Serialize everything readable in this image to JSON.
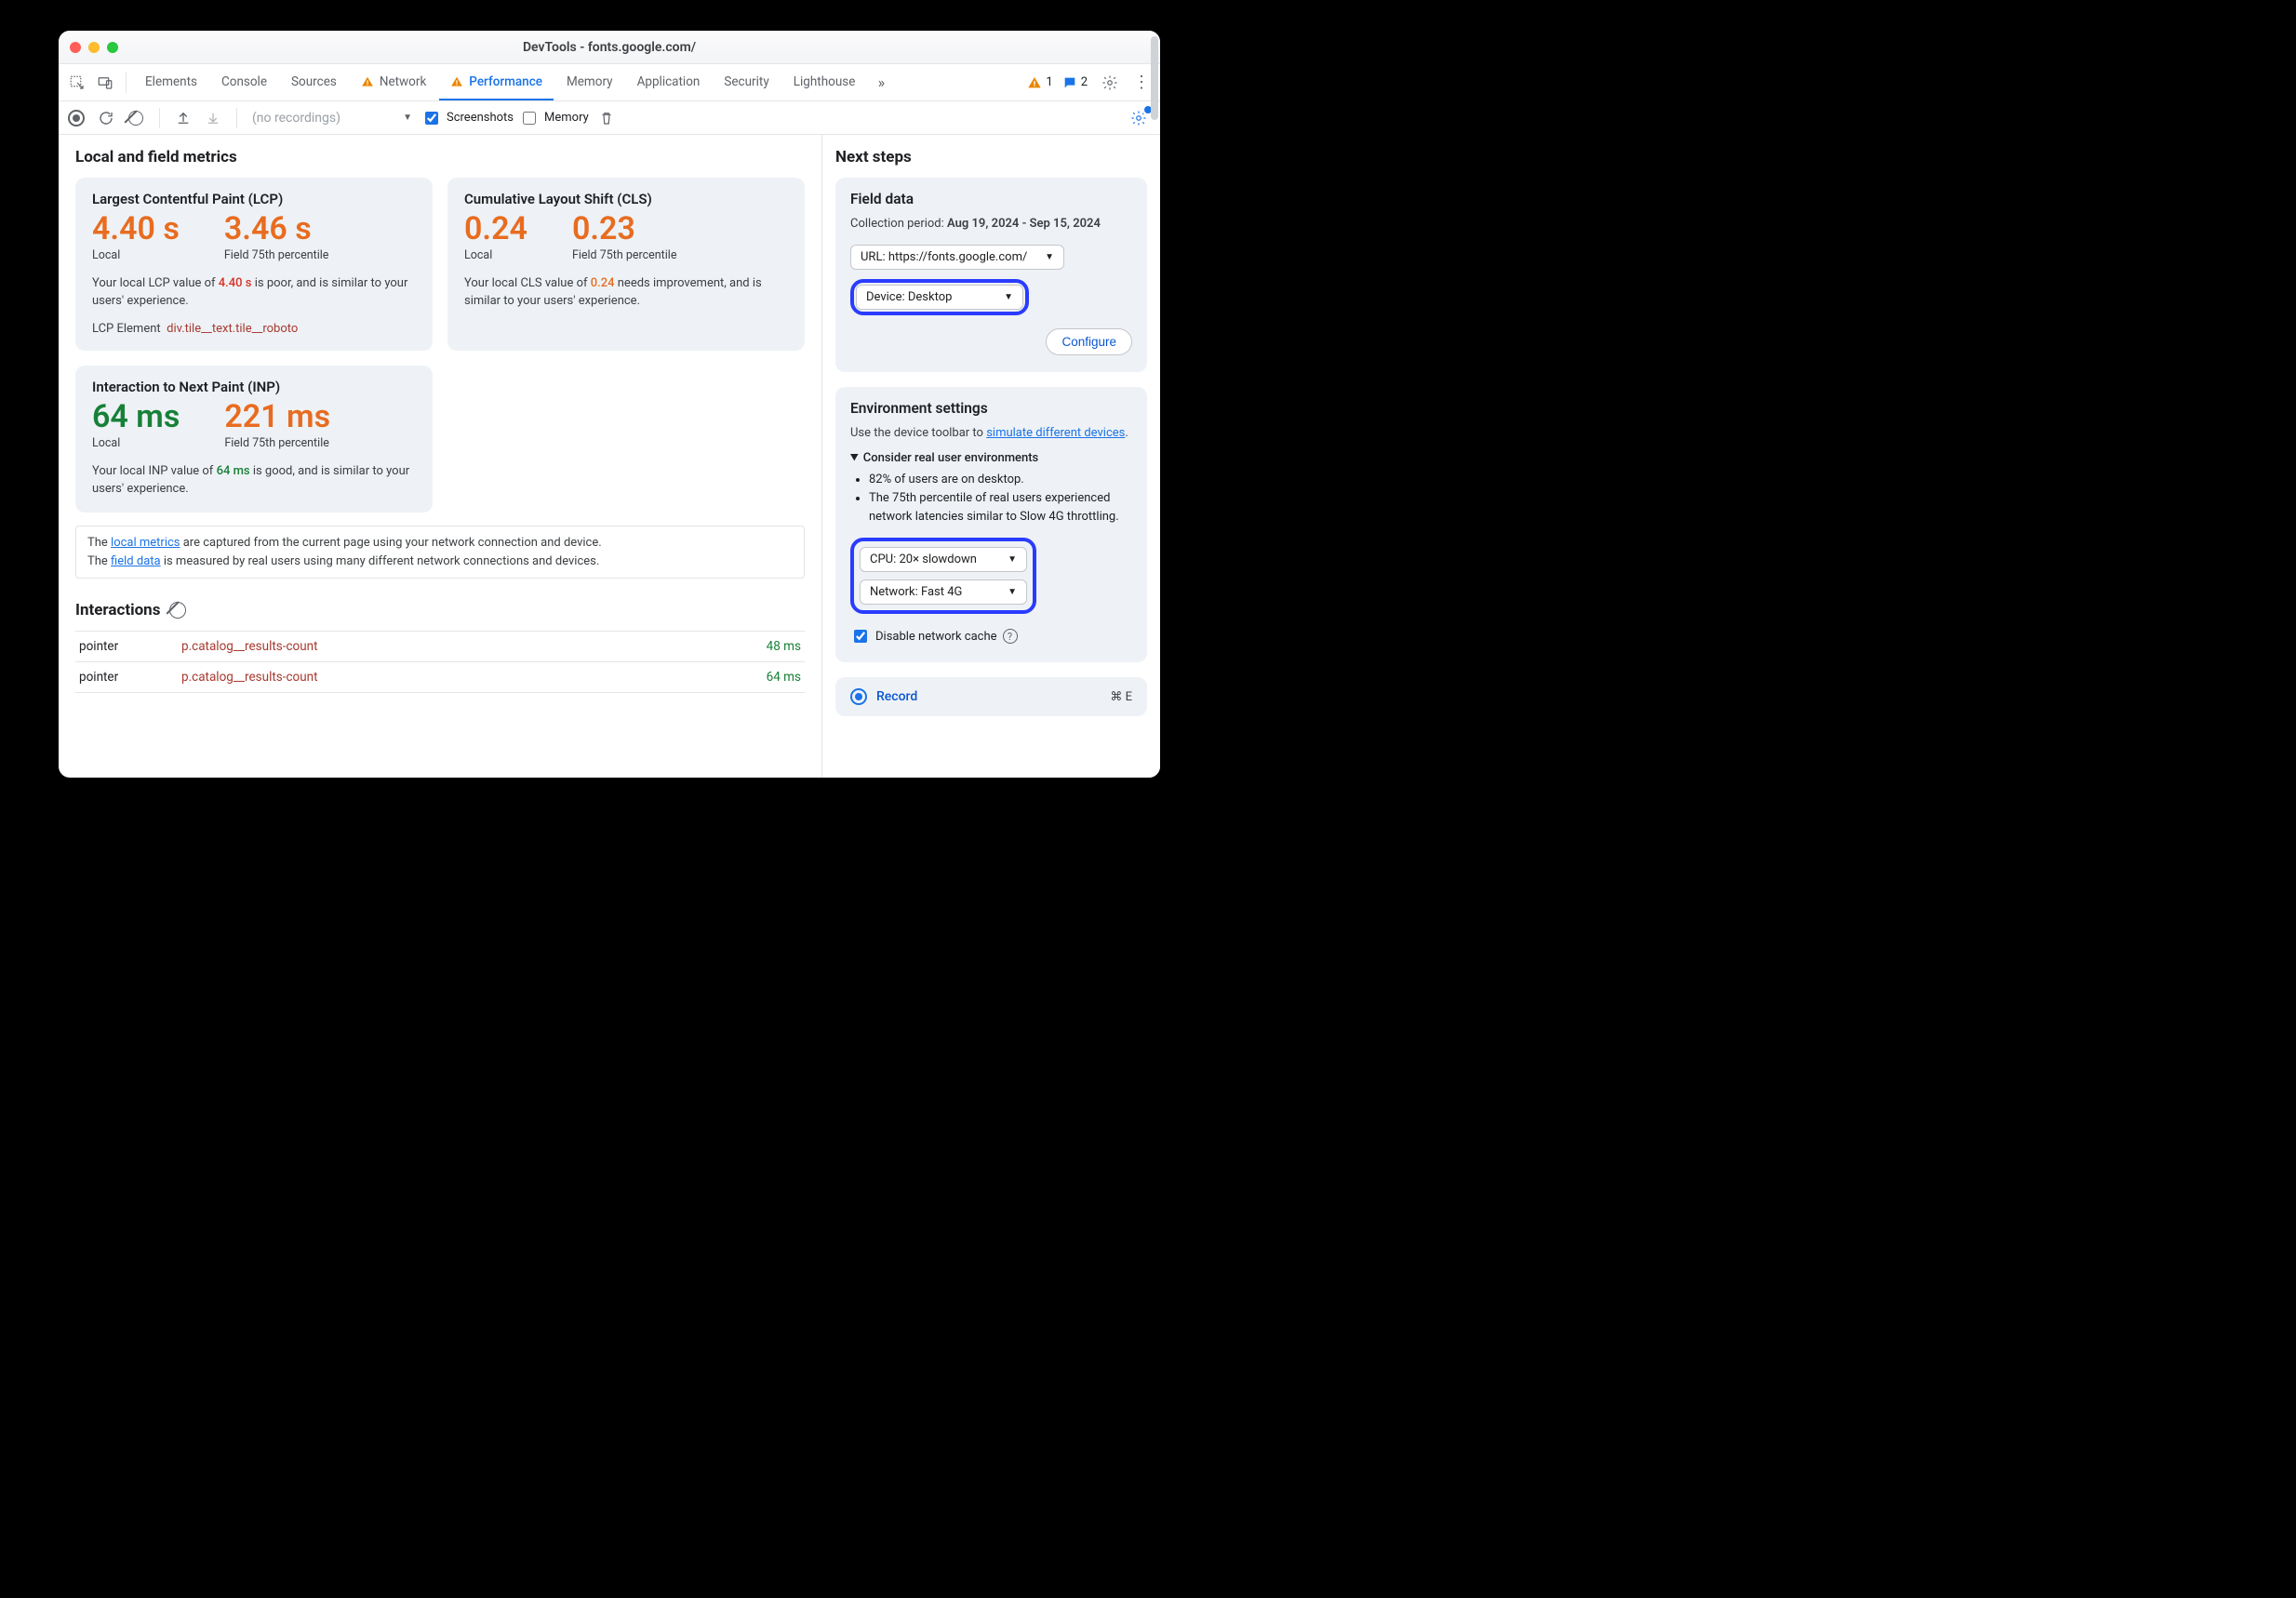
{
  "window": {
    "title": "DevTools - fonts.google.com/"
  },
  "tabs": {
    "items": [
      "Elements",
      "Console",
      "Sources",
      "Network",
      "Performance",
      "Memory",
      "Application",
      "Security",
      "Lighthouse"
    ],
    "warn_tabs": [
      "Network",
      "Performance"
    ],
    "active": "Performance"
  },
  "status": {
    "warnings": "1",
    "messages": "2"
  },
  "toolbar2": {
    "recordings_placeholder": "(no recordings)",
    "cb_screenshots": "Screenshots",
    "cb_memory": "Memory"
  },
  "main": {
    "heading": "Local and field metrics",
    "lcp": {
      "title": "Largest Contentful Paint (LCP)",
      "local_value": "4.40 s",
      "local_label": "Local",
      "field_value": "3.46 s",
      "field_label": "Field 75th percentile",
      "desc_pre": "Your local LCP value of ",
      "desc_val": "4.40 s",
      "desc_post": " is poor, and is similar to your users' experience.",
      "element_label": "LCP Element",
      "element_selector": "div.tile__text.tile__roboto"
    },
    "cls": {
      "title": "Cumulative Layout Shift (CLS)",
      "local_value": "0.24",
      "local_label": "Local",
      "field_value": "0.23",
      "field_label": "Field 75th percentile",
      "desc_pre": "Your local CLS value of ",
      "desc_val": "0.24",
      "desc_post": " needs improvement, and is similar to your users' experience."
    },
    "inp": {
      "title": "Interaction to Next Paint (INP)",
      "local_value": "64 ms",
      "local_label": "Local",
      "field_value": "221 ms",
      "field_label": "Field 75th percentile",
      "desc_pre": "Your local INP value of ",
      "desc_val": "64 ms",
      "desc_post": " is good, and is similar to your users' experience."
    },
    "info": {
      "line1a": "The ",
      "line1_link": "local metrics",
      "line1b": " are captured from the current page using your network connection and device.",
      "line2a": "The ",
      "line2_link": "field data",
      "line2b": " is measured by real users using many different network connections and devices."
    },
    "interactions_heading": "Interactions",
    "interactions": [
      {
        "type": "pointer",
        "selector": "p.catalog__results-count",
        "time": "48 ms"
      },
      {
        "type": "pointer",
        "selector": "p.catalog__results-count",
        "time": "64 ms"
      }
    ]
  },
  "side": {
    "heading": "Next steps",
    "field": {
      "title": "Field data",
      "period_label": "Collection period: ",
      "period_value": "Aug 19, 2024 - Sep 15, 2024",
      "url_select": "URL: https://fonts.google.com/",
      "device_select": "Device: Desktop",
      "configure": "Configure"
    },
    "env": {
      "title": "Environment settings",
      "desc_a": "Use the device toolbar to ",
      "desc_link": "simulate different devices",
      "desc_b": ".",
      "summary": "Consider real user environments",
      "bullets": [
        "82% of users are on desktop.",
        "The 75th percentile of real users experienced network latencies similar to Slow 4G throttling."
      ],
      "cpu_select": "CPU: 20× slowdown",
      "net_select": "Network: Fast 4G",
      "cache_cb": "Disable network cache"
    },
    "record": {
      "label": "Record",
      "shortcut": "⌘ E"
    }
  }
}
